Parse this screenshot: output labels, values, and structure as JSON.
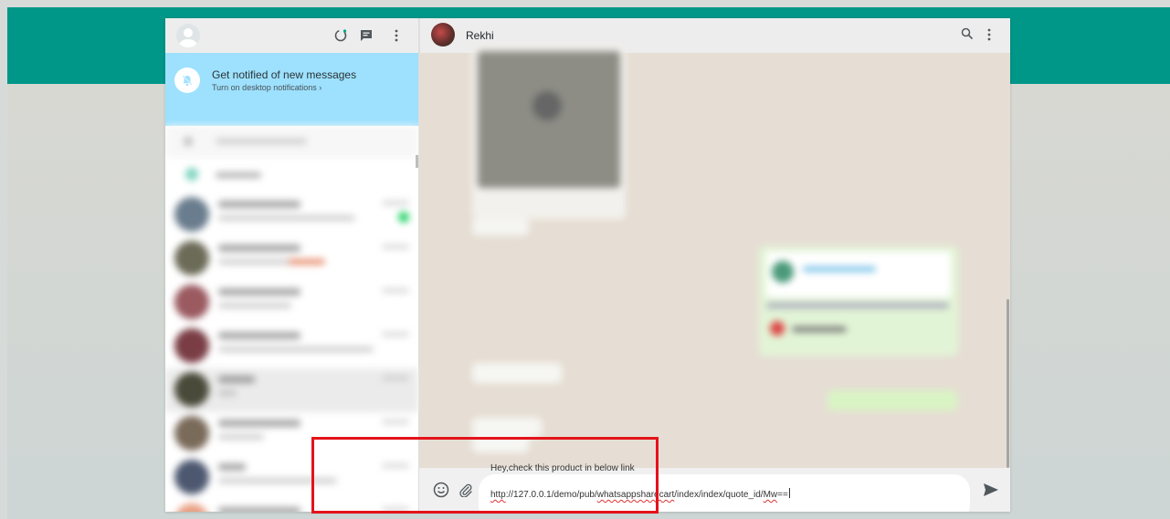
{
  "colors": {
    "teal_band": "#009688",
    "notification_banner": "#9de1fe",
    "highlight_box": "#e4131b",
    "conversation_background": "#e6ded4"
  },
  "left_header": {
    "icons": [
      "status-icon",
      "new-chat-icon",
      "menu-icon"
    ]
  },
  "notification": {
    "title": "Get notified of new messages",
    "subtitle": "Turn on desktop notifications ›"
  },
  "chat_header": {
    "contact_name": "Rekhi",
    "icons": [
      "search-icon",
      "menu-icon"
    ]
  },
  "composer": {
    "line1": "Hey,check this product in below link",
    "link_parts": [
      "http",
      "://127.0.0.1/demo/pub/",
      "whatsappsharecart",
      "/index/index/quote_id/",
      "Mw",
      "=="
    ],
    "icons": [
      "emoji-icon",
      "attach-icon",
      "send-icon"
    ]
  }
}
